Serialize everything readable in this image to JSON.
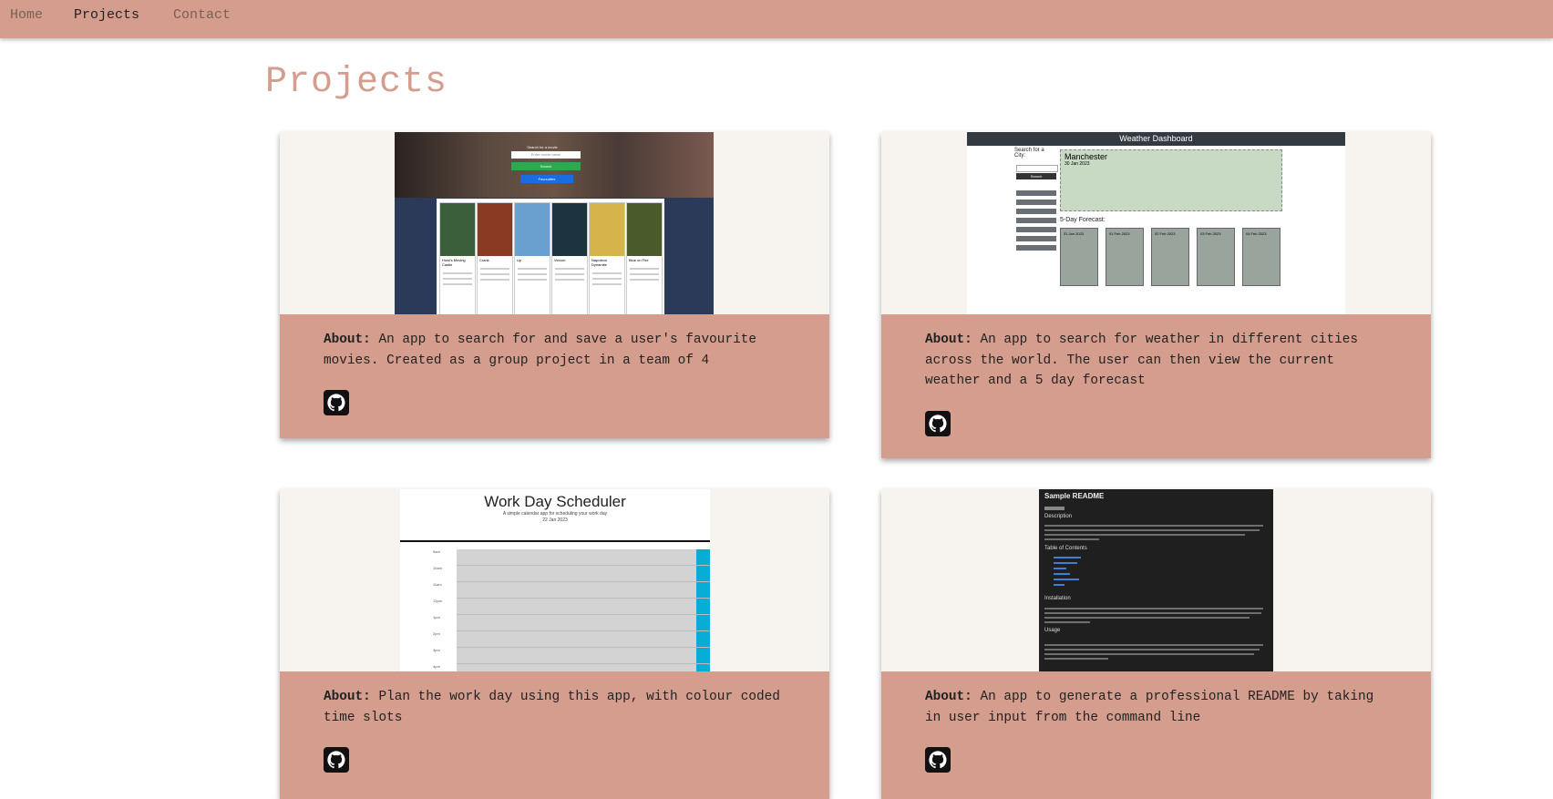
{
  "nav": {
    "items": [
      {
        "label": "Home",
        "active": false
      },
      {
        "label": "Projects",
        "active": true
      },
      {
        "label": "Contact",
        "active": false
      }
    ]
  },
  "page": {
    "title": "Projects"
  },
  "colors": {
    "accent": "#d49d8d",
    "card_media_bg": "#f7f3ef"
  },
  "projects": [
    {
      "about_label": "About:",
      "about_text": "An app to search for and save a user's favourite movies. Created as a group project in a team of 4",
      "screenshot": {
        "search_title": "Search for a movie",
        "search_placeholder": "Enter movie name",
        "search_button": "Search",
        "favourites_button": "Favourites",
        "movies": [
          "Howl's Moving Castle",
          "Crank",
          "Up",
          "Venom",
          "Napoleon Dynamite",
          "Blue on Fire"
        ]
      },
      "icon": "github-icon"
    },
    {
      "about_label": "About:",
      "about_text": "An app to search for weather in different cities across the world. The user can then view the current weather and a 5 day forecast",
      "screenshot": {
        "header": "Weather Dashboard",
        "search_label": "Search for a City:",
        "search_button": "Search",
        "city": "Manchester",
        "date": "30 Jan 2023",
        "forecast_title": "5-Day Forecast:",
        "forecast_dates": [
          "31 Jan 2023",
          "01 Feb 2023",
          "02 Feb 2023",
          "03 Feb 2023",
          "04 Feb 2023"
        ]
      },
      "icon": "github-icon"
    },
    {
      "about_label": "About:",
      "about_text": "Plan the work day using this app, with colour coded time slots",
      "screenshot": {
        "title": "Work Day Scheduler",
        "subtitle": "A simple calendar app for scheduling your work day",
        "date": "22 Jan 2023",
        "hours": [
          "9am",
          "10am",
          "11am",
          "12pm",
          "1pm",
          "2pm",
          "3pm",
          "4pm"
        ]
      },
      "icon": "github-icon"
    },
    {
      "about_label": "About:",
      "about_text": "An app to generate a professional README by taking in user input from the command line",
      "screenshot": {
        "title": "Sample README",
        "sections": [
          "Description",
          "Table of Contents",
          "Installation",
          "Usage"
        ]
      },
      "icon": "github-icon"
    }
  ]
}
